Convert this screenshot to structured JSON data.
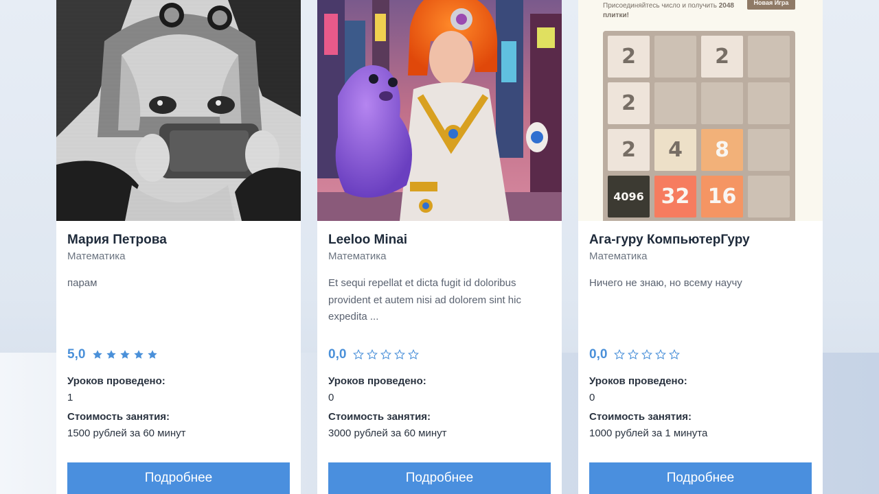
{
  "tutors": [
    {
      "name": "Мария Петрова",
      "subject": "Математика",
      "description": "парам",
      "rating": "5,0",
      "stars_filled": 5,
      "lessons_label": "Уроков проведено:",
      "lessons": "1",
      "price_label": "Стоимость занятия:",
      "price": "1500 рублей за 60 минут",
      "button": "Подробнее",
      "photo": "anime-girl-grayscale-photo"
    },
    {
      "name": "Leeloo Minai",
      "subject": "Математика",
      "description": "Et sequi repellat et dicta fugit id doloribus provident et autem nisi ad dolorem sint hic expedita ...",
      "rating": "0,0",
      "stars_filled": 0,
      "lessons_label": "Уроков проведено:",
      "lessons": "0",
      "price_label": "Стоимость занятия:",
      "price": "3000 рублей за 60 минут",
      "button": "Подробнее",
      "photo": "orange-hair-woman-with-purple-seal-photo"
    },
    {
      "name": "Ага-гуру КомпьютерГуру",
      "subject": "Математика",
      "description": "Ничего не знаю, но всему научу",
      "rating": "0,0",
      "stars_filled": 0,
      "lessons_label": "Уроков проведено:",
      "lessons": "0",
      "price_label": "Стоимость занятия:",
      "price": "1000 рублей за 1 минута",
      "button": "Подробнее",
      "photo": "game-2048-screenshot"
    }
  ],
  "game": {
    "intro": "Присоединяйтесь число и получить",
    "target": "2048",
    "intro2": "плитки!",
    "new_game": "Новая Игра",
    "tiles": [
      "2",
      "",
      "2",
      "",
      "2",
      "",
      "",
      "",
      "2",
      "4",
      "8",
      "",
      "4096",
      "32",
      "16",
      ""
    ]
  },
  "colors": {
    "accent": "#4a8fde",
    "star": "#4a90d9",
    "text_dark": "#1e2a3a",
    "text_muted": "#6b7480"
  }
}
